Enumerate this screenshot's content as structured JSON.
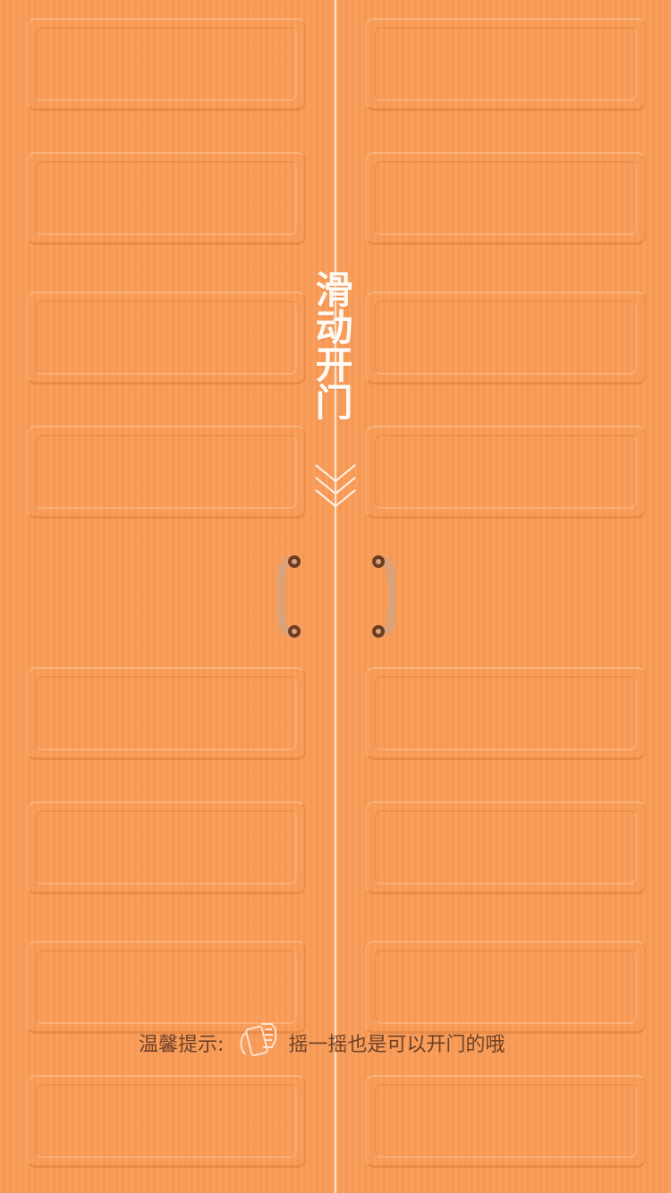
{
  "door": {
    "title": "滑动开门",
    "panel_rows": 8
  },
  "tip": {
    "label": "温馨提示:",
    "icon": "shake-phone-icon",
    "text": "摇一摇也是可以开门的哦"
  },
  "colors": {
    "door": "#f99b56",
    "seam": "#fbe6d2",
    "handle": "#d9a27a",
    "handle_ends": "#6b3d24",
    "title": "#fffaf4",
    "tip_text": "#6e4026"
  }
}
